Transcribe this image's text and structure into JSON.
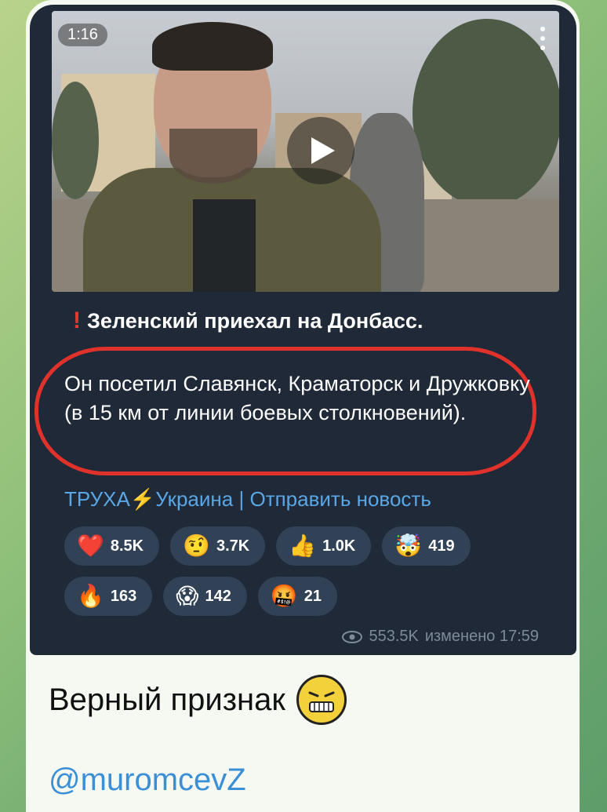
{
  "video": {
    "duration": "1:16"
  },
  "post": {
    "title": "Зеленский приехал на Донбасс.",
    "body": "Он посетил Славянск, Краматорск и Дружковку (в 15 км от линии боевых столкновений).",
    "link_channel": "ТРУХА",
    "link_country": "Украина",
    "link_separator": "|",
    "link_send": "Отправить новость",
    "views": "553.5K",
    "edited": "изменено 17:59"
  },
  "reactions": [
    {
      "emoji": "❤️",
      "count": "8.5K",
      "icon": "heart-icon"
    },
    {
      "emoji": "🤨",
      "count": "3.7K",
      "icon": "raised-eyebrow-icon"
    },
    {
      "emoji": "👍",
      "count": "1.0K",
      "icon": "thumbs-up-icon"
    },
    {
      "emoji": "🤯",
      "count": "419",
      "icon": "exploding-head-icon"
    },
    {
      "emoji": "🔥",
      "count": "163",
      "icon": "fire-icon"
    },
    {
      "emoji": "😱",
      "count": "142",
      "icon": "scream-icon"
    },
    {
      "emoji": "🤬",
      "count": "21",
      "icon": "cursing-face-icon"
    }
  ],
  "caption": "Верный признак",
  "handle": "@muromcevZ",
  "colors": {
    "accent": "#5aa7e5",
    "highlight": "#e0322b",
    "bubble": "#1f2937"
  }
}
